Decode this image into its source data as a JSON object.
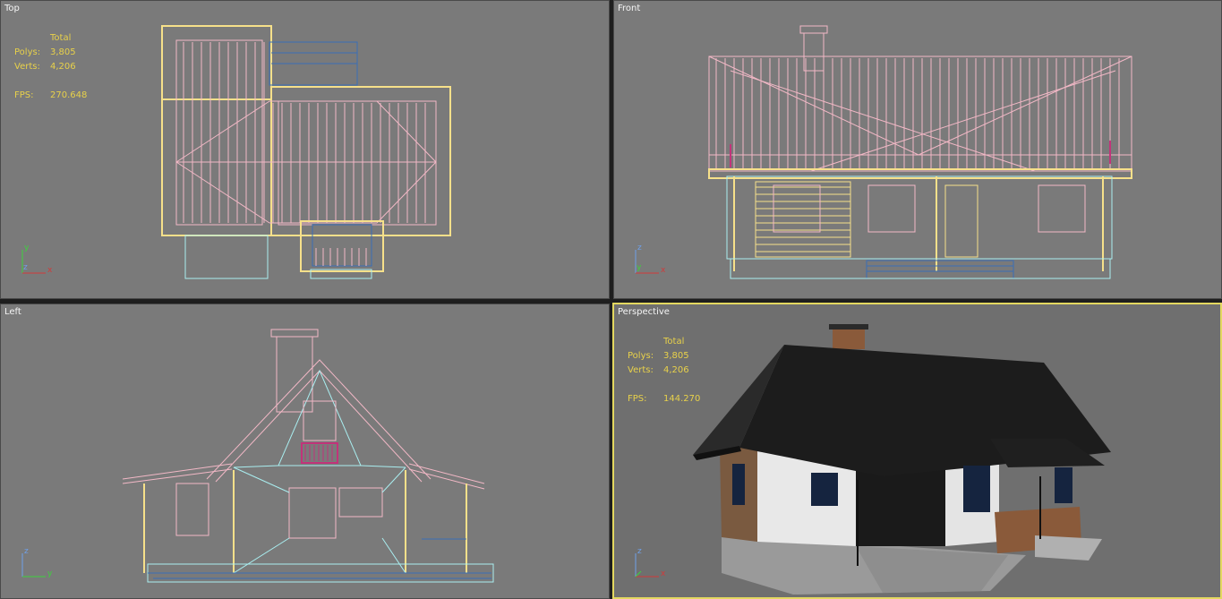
{
  "viewports": {
    "top": {
      "label": "Top",
      "stats": {
        "header": "Total",
        "polys_label": "Polys:",
        "polys": "3,805",
        "verts_label": "Verts:",
        "verts": "4,206",
        "fps_label": "FPS:",
        "fps": "270.648"
      },
      "axes": [
        "y",
        "z",
        "x"
      ]
    },
    "front": {
      "label": "Front",
      "axes": [
        "z",
        "y",
        "x"
      ]
    },
    "left": {
      "label": "Left",
      "axes": [
        "z",
        "y"
      ]
    },
    "perspective": {
      "label": "Perspective",
      "active": true,
      "stats": {
        "header": "Total",
        "polys_label": "Polys:",
        "polys": "3,805",
        "verts_label": "Verts:",
        "verts": "4,206",
        "fps_label": "FPS:",
        "fps": "144.270"
      },
      "axes": [
        "z",
        "x"
      ]
    }
  },
  "colors": {
    "viewport_bg": "#7a7a7a",
    "active_border": "#e3d860",
    "stats_text": "#e8d14a",
    "wire_pink": "#f2b8c6",
    "wire_yellow": "#f6e08a",
    "wire_cyan": "#a9eef0",
    "wire_blue": "#3a6fb6",
    "wire_magenta": "#c2337a",
    "roof_dark": "#1c1c1c"
  }
}
